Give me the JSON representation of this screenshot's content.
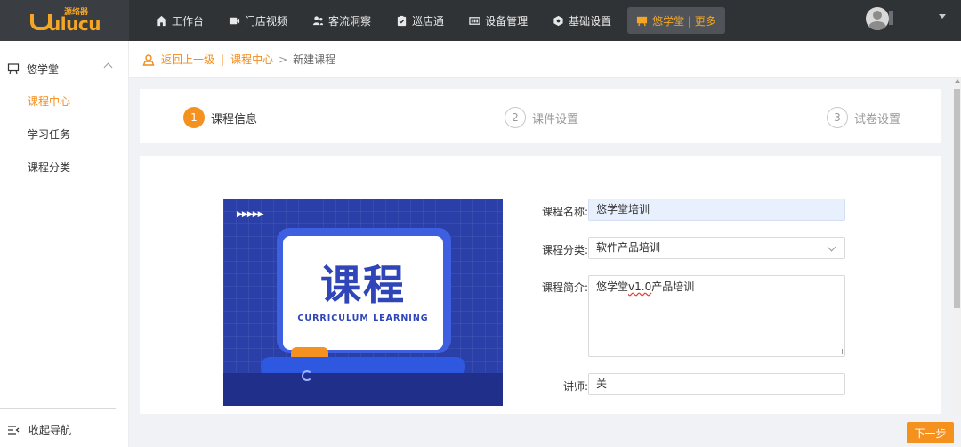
{
  "brand": {
    "name_cn": "源络器",
    "name_en": "ulucu"
  },
  "nav": {
    "items": [
      {
        "label": "工作台",
        "icon": "home-icon"
      },
      {
        "label": "门店视频",
        "icon": "video-icon"
      },
      {
        "label": "客流洞察",
        "icon": "people-icon"
      },
      {
        "label": "巡店通",
        "icon": "checklist-icon"
      },
      {
        "label": "设备管理",
        "icon": "device-icon"
      },
      {
        "label": "基础设置",
        "icon": "settings-icon"
      },
      {
        "label": "悠学堂 | 更多",
        "icon": "teach-icon"
      }
    ],
    "active_color": "#f5a623"
  },
  "sidebar": {
    "group": "悠学堂",
    "items": [
      {
        "label": "课程中心",
        "active": true
      },
      {
        "label": "学习任务",
        "active": false
      },
      {
        "label": "课程分类",
        "active": false
      }
    ],
    "collapse_label": "收起导航"
  },
  "breadcrumb": {
    "back": "返回上一级",
    "sep": "|",
    "parent": "课程中心",
    "arrow": ">",
    "current": "新建课程"
  },
  "steps": [
    {
      "num": "1",
      "label": "课程信息",
      "state": "active"
    },
    {
      "num": "2",
      "label": "课件设置",
      "state": "idle"
    },
    {
      "num": "3",
      "label": "试卷设置",
      "state": "idle"
    }
  ],
  "cover": {
    "title": "课程",
    "subtitle": "CURRICULUM LEARNING"
  },
  "form": {
    "name_label": "课程名称:",
    "name_value": "悠学堂培训",
    "category_label": "课程分类:",
    "category_value": "软件产品培训",
    "intro_label": "课程简介:",
    "intro_prefix": "悠学堂",
    "intro_squiggle": "v1.0",
    "intro_suffix": "产品培训",
    "teacher_label": "讲师:",
    "teacher_value": "关"
  },
  "actions": {
    "next_label": "下一步"
  },
  "colors": {
    "accent": "#f5911e",
    "topbar": "#303336",
    "cover_bg": "#2b3fa8"
  }
}
